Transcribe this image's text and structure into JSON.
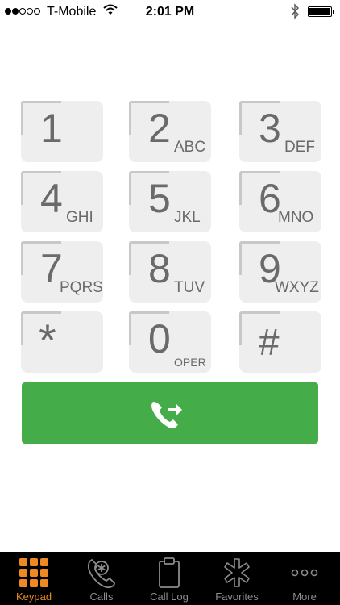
{
  "status_bar": {
    "carrier": "T-Mobile",
    "time": "2:01 PM",
    "signal_bars_filled": 2,
    "signal_bars_total": 5,
    "battery_level": 1.0
  },
  "keypad": {
    "keys": [
      {
        "digit": "1",
        "letters": ""
      },
      {
        "digit": "2",
        "letters": "ABC"
      },
      {
        "digit": "3",
        "letters": "DEF"
      },
      {
        "digit": "4",
        "letters": "GHI"
      },
      {
        "digit": "5",
        "letters": "JKL"
      },
      {
        "digit": "6",
        "letters": "MNO"
      },
      {
        "digit": "7",
        "letters": "PQRS"
      },
      {
        "digit": "8",
        "letters": "TUV"
      },
      {
        "digit": "9",
        "letters": "WXYZ"
      },
      {
        "digit": "*",
        "letters": ""
      },
      {
        "digit": "0",
        "letters": "OPER"
      },
      {
        "digit": "#",
        "letters": ""
      }
    ]
  },
  "call_button": {
    "icon": "phone-forward-icon",
    "color": "#44ad4a"
  },
  "tab_bar": {
    "active_color": "#ef8a21",
    "inactive_color": "#8c8c8c",
    "tabs": [
      {
        "label": "Keypad",
        "icon": "keypad-grid-icon",
        "active": true
      },
      {
        "label": "Calls",
        "icon": "phone-asterisk-icon",
        "active": false
      },
      {
        "label": "Call Log",
        "icon": "clipboard-icon",
        "active": false
      },
      {
        "label": "Favorites",
        "icon": "asterisk-star-icon",
        "active": false
      },
      {
        "label": "More",
        "icon": "more-dots-icon",
        "active": false
      }
    ]
  }
}
